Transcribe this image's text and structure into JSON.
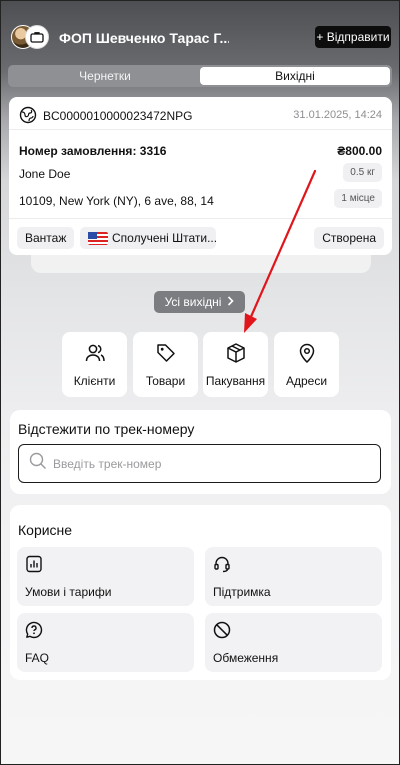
{
  "header": {
    "title": "ФОП Шевченко Тарас Г...",
    "send_button": "+ Відправити"
  },
  "tabs": [
    {
      "label": "Чернетки",
      "active": false
    },
    {
      "label": "Вихідні",
      "active": true
    }
  ],
  "order": {
    "tracking_number": "BC0000010000023472NPG",
    "date": "31.01.2025, 14:24",
    "order_label": "Номер замовлення: 3316",
    "price": "₴800.00",
    "recipient": "Jone Doe",
    "weight": "0.5 кг",
    "address": "10109, New York (NY), 6 ave, 88, 14",
    "places": "1 місце",
    "cargo_type": "Вантаж",
    "country": "Сполучені Штати...",
    "status": "Створена"
  },
  "all_sent_button": "Усі вихідні",
  "quick_actions": [
    {
      "label": "Клієнти",
      "icon": "users-icon"
    },
    {
      "label": "Товари",
      "icon": "tag-icon"
    },
    {
      "label": "Пакування",
      "icon": "box-icon"
    },
    {
      "label": "Адреси",
      "icon": "map-pin-icon"
    }
  ],
  "track": {
    "title": "Відстежити по трек-номеру",
    "placeholder": "Введіть трек-номер"
  },
  "useful": {
    "title": "Корисне",
    "items": [
      {
        "label": "Умови і тарифи",
        "icon": "chart-icon"
      },
      {
        "label": "Підтримка",
        "icon": "headset-icon"
      },
      {
        "label": "FAQ",
        "icon": "question-icon"
      },
      {
        "label": "Обмеження",
        "icon": "prohibited-icon"
      }
    ]
  },
  "colors": {
    "arrow": "#e0161c",
    "send_button_bg": "#0d0d0d"
  }
}
